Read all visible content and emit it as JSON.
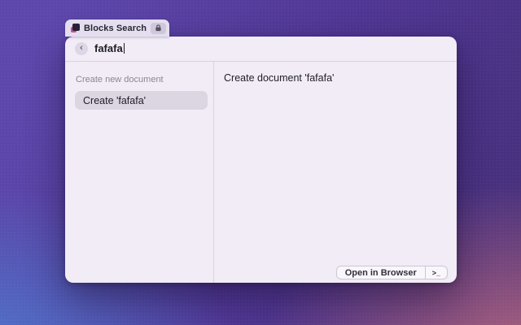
{
  "launcher_pill": {
    "label": "Blocks Search",
    "app_icon": "blocks-logo",
    "badge_icon": "lock"
  },
  "window": {
    "search": {
      "back_icon": "‹",
      "value": "fafafa"
    },
    "left_panel": {
      "section_header": "Create new document",
      "items": [
        {
          "label": "Create 'fafafa'",
          "selected": true
        }
      ]
    },
    "detail_panel": {
      "title": "Create document 'fafafa'"
    },
    "footer": {
      "primary_action": "Open in Browser",
      "terminal_icon": ">_"
    }
  },
  "colors": {
    "background_purple": "#54399b",
    "background_blue": "#4e79cf",
    "background_pink": "#b4657f",
    "window_bg": "#f1ecf6",
    "selection_bg": "#dcd5e2",
    "divider": "#d9d2e0",
    "text_primary": "#1d1b24",
    "text_secondary": "#8b8794"
  }
}
